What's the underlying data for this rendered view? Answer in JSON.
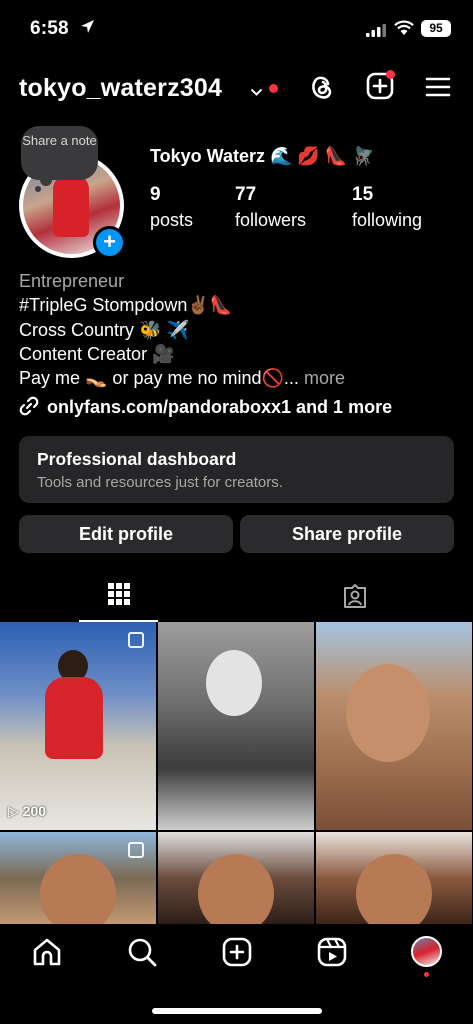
{
  "status_bar": {
    "time": "6:58",
    "battery": "95"
  },
  "header": {
    "username": "tokyo_waterz304"
  },
  "profile": {
    "note": "Share a note",
    "display_name": "Tokyo Waterz 🌊 💋 👠 🪰",
    "stats": [
      {
        "value": "9",
        "label": "posts"
      },
      {
        "value": "77",
        "label": "followers"
      },
      {
        "value": "15",
        "label": "following"
      }
    ],
    "bio": {
      "category": "Entrepreneur",
      "hashtag": "#TripleG",
      "line1_rest": " Stompdown✌🏾👠",
      "line2": "Cross Country 🐝 ✈️",
      "line3": "Content Creator 🎥",
      "line4": "Pay me 👡 or pay me no mind🚫...",
      "more": "more"
    },
    "link": "onlyfans.com/pandoraboxx1 and 1 more"
  },
  "dashboard": {
    "title": "Professional dashboard",
    "subtitle": "Tools and resources just for creators."
  },
  "buttons": {
    "edit": "Edit profile",
    "share": "Share profile"
  },
  "feed": {
    "first_post_views": "200"
  }
}
